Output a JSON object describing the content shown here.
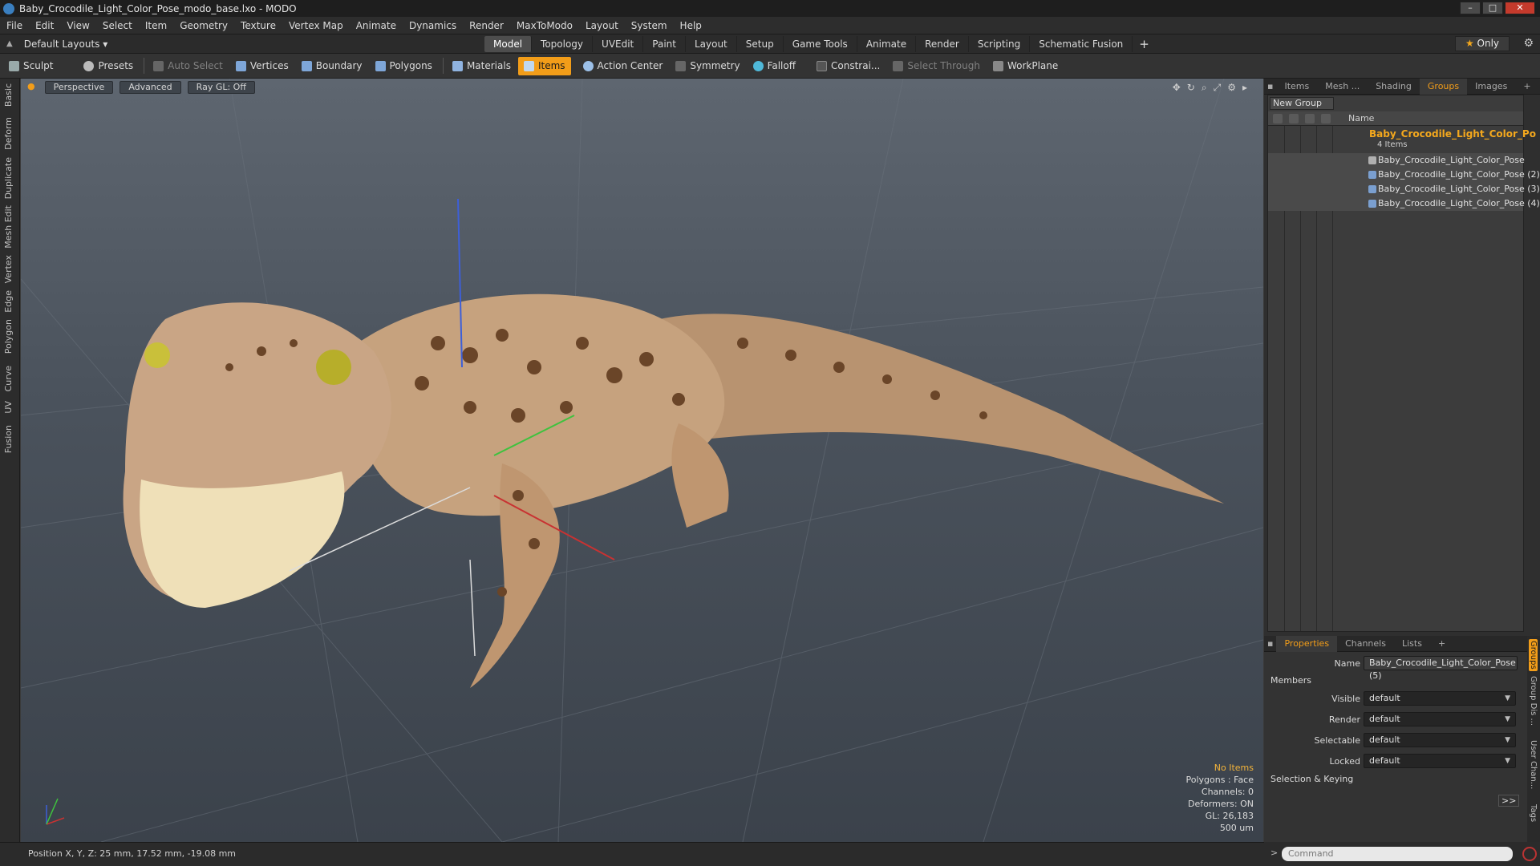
{
  "window": {
    "title": "Baby_Crocodile_Light_Color_Pose_modo_base.lxo - MODO",
    "minimize": "–",
    "maximize": "□",
    "close": "✕"
  },
  "menu": [
    "File",
    "Edit",
    "View",
    "Select",
    "Item",
    "Geometry",
    "Texture",
    "Vertex Map",
    "Animate",
    "Dynamics",
    "Render",
    "MaxToModo",
    "Layout",
    "System",
    "Help"
  ],
  "layouts": {
    "label": "Default Layouts ▾"
  },
  "mode_tabs": [
    "Model",
    "Topology",
    "UVEdit",
    "Paint",
    "Layout",
    "Setup",
    "Game Tools",
    "Animate",
    "Render",
    "Scripting",
    "Schematic Fusion"
  ],
  "active_mode_tab": "Model",
  "plus": "+",
  "only_label": "Only",
  "star": "★",
  "toolbar": {
    "sculpt": "Sculpt",
    "presets": "Presets",
    "auto_select": "Auto Select",
    "vertices": "Vertices",
    "boundary": "Boundary",
    "polygons": "Polygons",
    "materials": "Materials",
    "items": "Items",
    "action_center": "Action Center",
    "symmetry": "Symmetry",
    "falloff": "Falloff",
    "constraints": "Constrai...",
    "select_through": "Select Through",
    "workplane": "WorkPlane"
  },
  "left_tabs": [
    "Basic",
    "Deform",
    "Duplicate",
    "Mesh Edit",
    "Vertex",
    "Edge",
    "Polygon",
    "Curve",
    "UV",
    "Fusion"
  ],
  "viewport": {
    "perspective": "Perspective",
    "advanced": "Advanced",
    "raygl": "Ray GL: Off"
  },
  "stats": {
    "items": "No Items",
    "polygons": "Polygons : Face",
    "channels": "Channels: 0",
    "deformers": "Deformers: ON",
    "gl": "GL: 26,183",
    "scale": "500 um"
  },
  "status": {
    "position": "Position X, Y, Z:  25 mm, 17.52 mm, -19.08 mm"
  },
  "right_tabs": [
    "Items",
    "Mesh ...",
    "Shading",
    "Groups",
    "Images"
  ],
  "active_right_tab": "Groups",
  "groups": {
    "new_group": "New Group",
    "col_name": "Name",
    "root": "Baby_Crocodile_Light_Color_Po ...",
    "root_count": "4 Items",
    "items": [
      "Baby_Crocodile_Light_Color_Pose",
      "Baby_Crocodile_Light_Color_Pose (2)",
      "Baby_Crocodile_Light_Color_Pose (3)",
      "Baby_Crocodile_Light_Color_Pose (4)"
    ]
  },
  "prop_tabs": [
    "Properties",
    "Channels",
    "Lists"
  ],
  "properties": {
    "name_label": "Name",
    "name_value": "Baby_Crocodile_Light_Color_Pose (5)",
    "members": "Members",
    "visible_label": "Visible",
    "visible_value": "default",
    "render_label": "Render",
    "render_value": "default",
    "selectable_label": "Selectable",
    "selectable_value": "default",
    "locked_label": "Locked",
    "locked_value": "default",
    "selection_keying": "Selection & Keying",
    "more": ">>"
  },
  "right_vtabs": [
    "Groups",
    "Group Dis ...",
    "User Chan...",
    "Tags"
  ],
  "command": {
    "placeholder": "Command"
  },
  "colors": {
    "accent": "#f29d19",
    "title_orange": "#f4a81d"
  }
}
